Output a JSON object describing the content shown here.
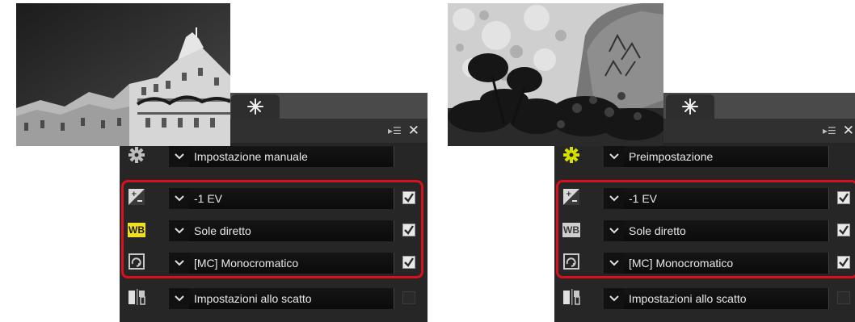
{
  "panels": [
    {
      "id": "left",
      "preset_value": "Impostazione manuale",
      "settings_icon_color": "#bdbdbd",
      "wb_bg": "#f0e020",
      "wb_fg": "#1a1a1a",
      "photo": "building-photo"
    },
    {
      "id": "right",
      "preset_value": "Preimpostazione",
      "settings_icon_color": "#d4e000",
      "wb_bg": "#cfcfcf",
      "wb_fg": "#3a3a3a",
      "photo": "flowers-stone-photo"
    }
  ],
  "rows": {
    "exposure": "-1 EV",
    "white_balance": "Sole diretto",
    "picture_control": "[MC] Monocromatico",
    "shooting": "Impostazioni allo scatto"
  },
  "checkboxes": {
    "exposure": true,
    "white_balance": true,
    "picture_control": true,
    "shooting": false
  },
  "icons": {
    "tab": "sparkle-icon",
    "header": [
      "list-arrow-icon",
      "close-icon"
    ],
    "rows": [
      "gear-icon",
      "exposure-compensation-icon",
      "white-balance-icon",
      "picture-control-icon",
      "shooting-settings-icon"
    ]
  },
  "wb_label": "WB",
  "highlight_color": "#d9101d"
}
